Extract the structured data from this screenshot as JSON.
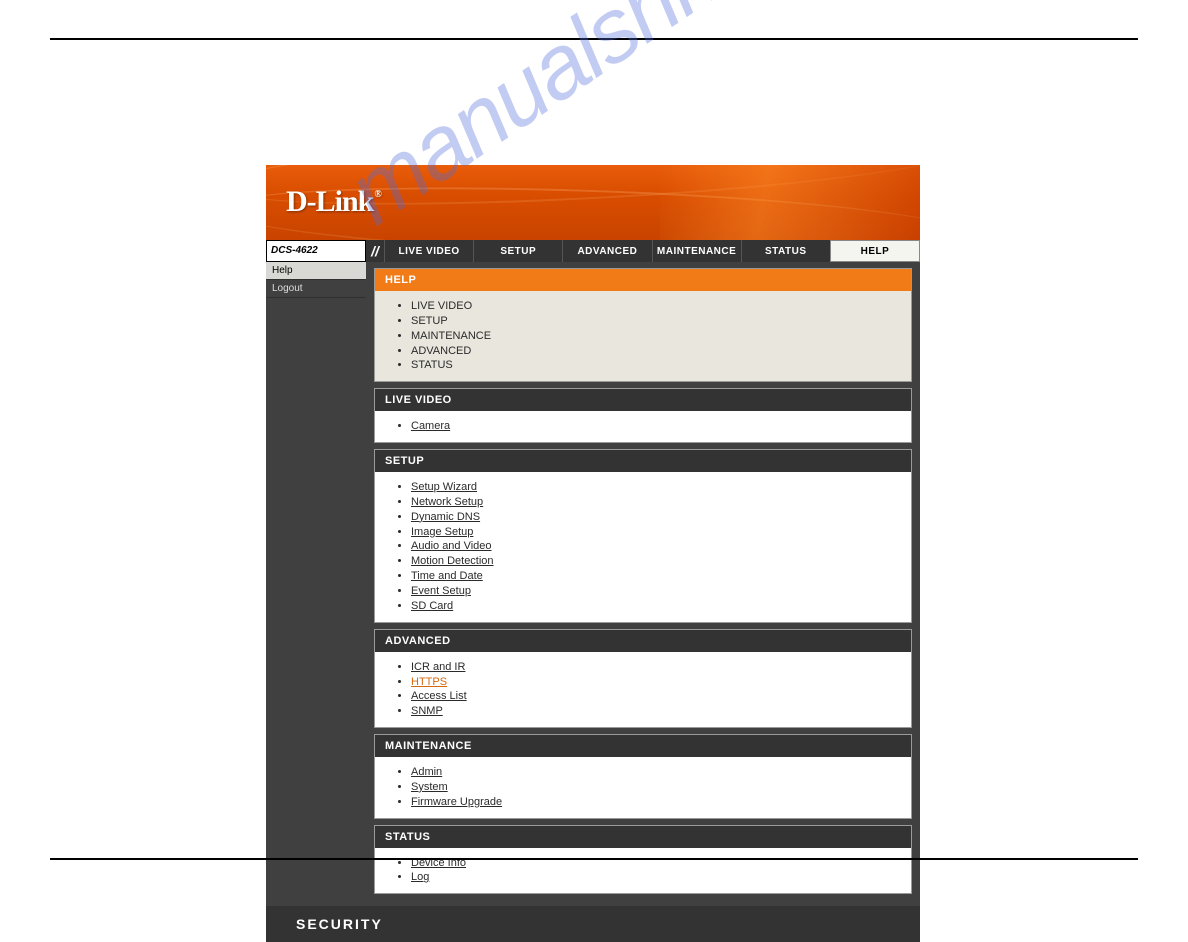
{
  "brand": "D-Link",
  "model": "DCS-4622",
  "watermark": "manualshive.com",
  "topnav": [
    {
      "label": "LIVE VIDEO",
      "active": false
    },
    {
      "label": "SETUP",
      "active": false
    },
    {
      "label": "ADVANCED",
      "active": false
    },
    {
      "label": "MAINTENANCE",
      "active": false
    },
    {
      "label": "STATUS",
      "active": false
    },
    {
      "label": "HELP",
      "active": true
    }
  ],
  "sidebar": [
    {
      "label": "Help",
      "active": true
    },
    {
      "label": "Logout",
      "active": false
    }
  ],
  "sections": {
    "help": {
      "title": "HELP",
      "items": [
        "LIVE VIDEO",
        "SETUP",
        "MAINTENANCE",
        "ADVANCED",
        "STATUS"
      ]
    },
    "live_video": {
      "title": "LIVE VIDEO",
      "items": [
        "Camera"
      ]
    },
    "setup": {
      "title": "SETUP",
      "items": [
        "Setup Wizard",
        "Network Setup",
        "Dynamic DNS",
        "Image Setup",
        "Audio and Video",
        "Motion Detection",
        "Time and Date",
        "Event Setup",
        "SD Card"
      ]
    },
    "advanced": {
      "title": "ADVANCED",
      "items": [
        "ICR and IR",
        "HTTPS",
        "Access List",
        "SNMP"
      ],
      "highlight_index": 1
    },
    "maintenance": {
      "title": "MAINTENANCE",
      "items": [
        "Admin",
        "System",
        "Firmware Upgrade"
      ]
    },
    "status": {
      "title": "STATUS",
      "items": [
        "Device Info",
        "Log"
      ]
    }
  },
  "footer": "SECURITY"
}
